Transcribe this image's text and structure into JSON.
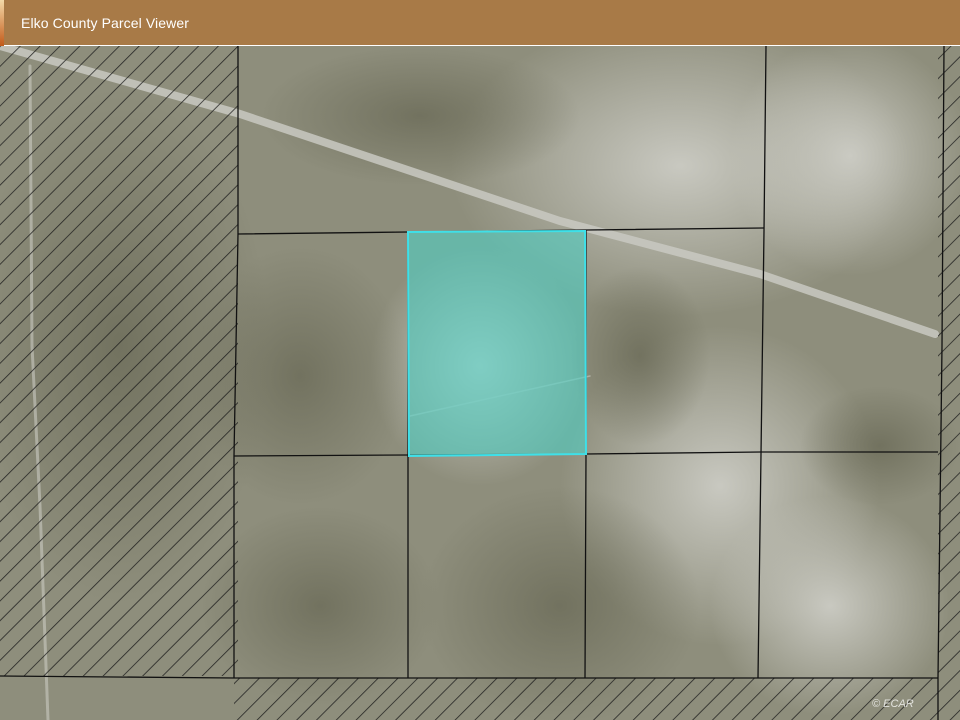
{
  "app": {
    "title": "Elko County Parcel Viewer"
  },
  "map": {
    "attribution": "© ECAR",
    "colors": {
      "header": "#a87a47",
      "parcel_line": "#111111",
      "selected_fill": "#4fd1c5",
      "selected_outline": "#3fe0e8",
      "hatch": "#1a1a1a"
    }
  }
}
